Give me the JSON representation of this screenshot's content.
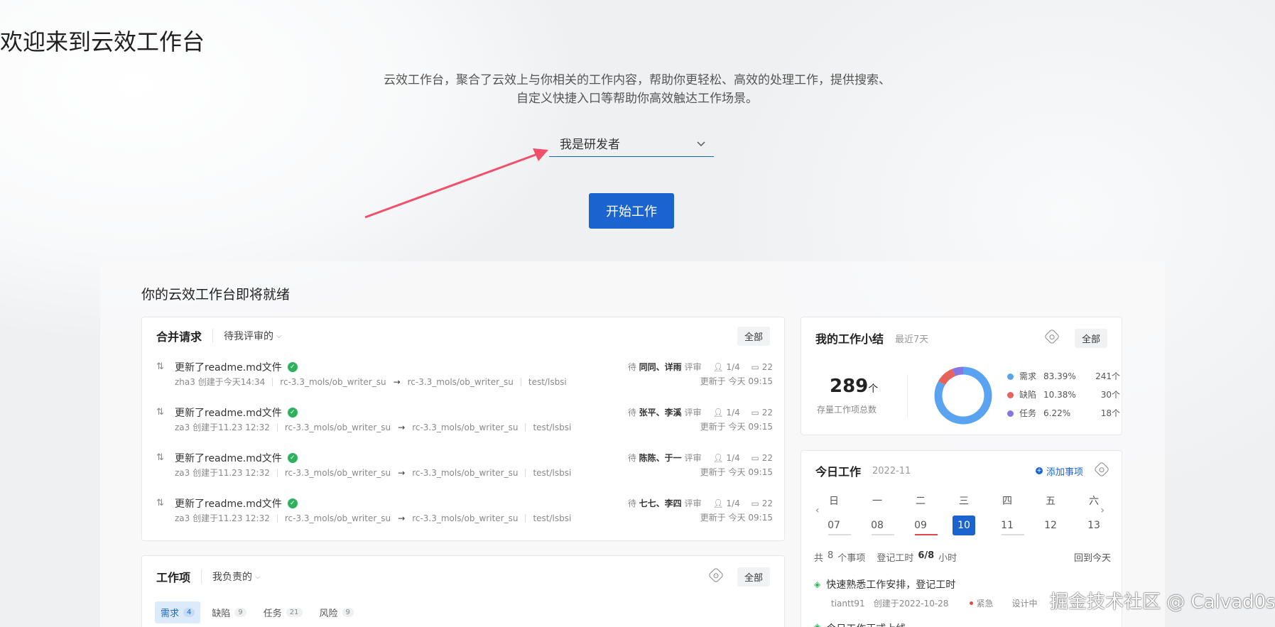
{
  "hero": {
    "title": "欢迎来到云效工作台",
    "desc_line1": "云效工作台，聚合了云效上与你相关的工作内容，帮助你更轻松、高效的处理工作，提供搜索、",
    "desc_line2": "自定义快捷入口等帮助你高效触达工作场景。",
    "role_value": "我是研发者",
    "start_label": "开始工作"
  },
  "panel": {
    "title": "你的云效工作台即将就绪"
  },
  "merge_requests": {
    "title": "合并请求",
    "filter": "待我评审的",
    "all_label": "全部",
    "items": [
      {
        "title": "更新了readme.md文件",
        "author": "zha3 创建于今天14:34",
        "from": "rc-3.3_mols/ob_writer_su",
        "to": "rc-3.3_mols/ob_writer_su",
        "repo": "test/lsbsi",
        "pending": "待",
        "reviewers": "同同、详雨",
        "review": "评审",
        "approvals": "1/4",
        "comments": "22",
        "updated": "更新于 今天 09:15"
      },
      {
        "title": "更新了readme.md文件",
        "author": "za3 创建于11.23 12:32",
        "from": "rc-3.3_mols/ob_writer_su",
        "to": "rc-3.3_mols/ob_writer_su",
        "repo": "test/lsbsi",
        "pending": "待",
        "reviewers": "张平、李溪",
        "review": "评审",
        "approvals": "1/4",
        "comments": "22",
        "updated": "更新于 今天 09:15"
      },
      {
        "title": "更新了readme.md文件",
        "author": "za3 创建于11.23 12:32",
        "from": "rc-3.3_mols/ob_writer_su",
        "to": "rc-3.3_mols/ob_writer_su",
        "repo": "test/lsbsi",
        "pending": "待",
        "reviewers": "陈陈、于一",
        "review": "评审",
        "approvals": "1/4",
        "comments": "22",
        "updated": "更新于 今天 09:15"
      },
      {
        "title": "更新了readme.md文件",
        "author": "za3 创建于11.23 12:32",
        "from": "rc-3.3_mols/ob_writer_su",
        "to": "rc-3.3_mols/ob_writer_su",
        "repo": "test/lsbsi",
        "pending": "待",
        "reviewers": "七七、李四",
        "review": "评审",
        "approvals": "1/4",
        "comments": "22",
        "updated": "更新于 今天 09:15"
      }
    ]
  },
  "work_items": {
    "title": "工作项",
    "filter": "我负责的",
    "all_label": "全部",
    "tabs": [
      {
        "label": "需求",
        "count": "4"
      },
      {
        "label": "缺陷",
        "count": "9"
      },
      {
        "label": "任务",
        "count": "21"
      },
      {
        "label": "风险",
        "count": "9"
      }
    ]
  },
  "summary": {
    "title": "我的工作小结",
    "range": "最近7天",
    "all_label": "全部",
    "total": "289",
    "unit": "个",
    "total_label": "存量工作项总数",
    "legend": [
      {
        "name": "需求",
        "pct": "83.39%",
        "count": "241个",
        "color": "#5aa3f0"
      },
      {
        "name": "缺陷",
        "pct": "10.38%",
        "count": "30个",
        "color": "#e8625c"
      },
      {
        "name": "任务",
        "pct": "6.22%",
        "count": "18个",
        "color": "#8a74e0"
      }
    ],
    "chart_data": {
      "type": "pie",
      "categories": [
        "需求",
        "缺陷",
        "任务"
      ],
      "values": [
        83.39,
        10.38,
        6.22
      ]
    }
  },
  "today": {
    "title": "今日工作",
    "month": "2022-11",
    "add_label": "添加事项",
    "weekdays": [
      "日",
      "一",
      "二",
      "三",
      "四",
      "五",
      "六"
    ],
    "dates": [
      "07",
      "08",
      "09",
      "10",
      "11",
      "12",
      "13"
    ],
    "total_prefix": "共",
    "total_count": "8",
    "total_suffix": "个事项",
    "hours_label": "登记工时",
    "hours_value": "6/8",
    "hours_unit": "小时",
    "back_today": "回到今天",
    "task_title": "快速熟悉工作安排，登记工时",
    "task_user": "tiantt91",
    "task_created": "创建于2022-10-28",
    "task_priority": "紧急",
    "task_status": "设计中",
    "task2_title": "今日工作正式上线"
  },
  "watermark": "掘金技术社区 @ Calvad0s"
}
